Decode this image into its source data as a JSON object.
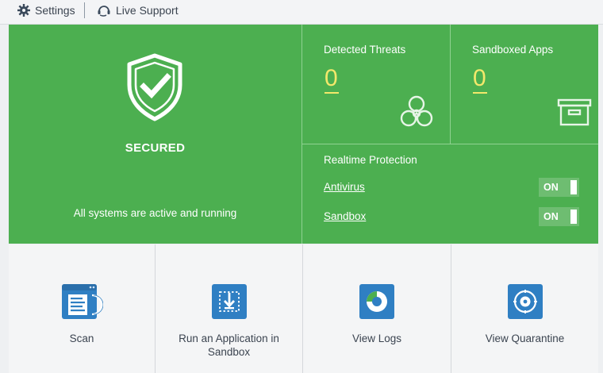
{
  "toolbar": {
    "settings_label": "Settings",
    "settings_icon": "gear-icon",
    "support_label": "Live Support",
    "support_icon": "headset-icon"
  },
  "status": {
    "icon": "shield-check-icon",
    "title": "SECURED",
    "message": "All systems are active and running"
  },
  "threats": {
    "title": "Detected Threats",
    "count": "0",
    "icon": "biohazard-icon"
  },
  "sandboxed": {
    "title": "Sandboxed Apps",
    "count": "0",
    "icon": "sandbox-box-icon"
  },
  "realtime": {
    "title": "Realtime Protection",
    "items": [
      {
        "label": "Antivirus",
        "state": "ON"
      },
      {
        "label": "Sandbox",
        "state": "ON"
      }
    ]
  },
  "tiles": [
    {
      "label": "Scan",
      "icon": "scan-document-icon"
    },
    {
      "label": "Run an Application in Sandbox",
      "icon": "sandbox-run-icon"
    },
    {
      "label": "View Logs",
      "icon": "logs-chart-icon"
    },
    {
      "label": "View Quarantine",
      "icon": "quarantine-vault-icon"
    }
  ],
  "colors": {
    "panel_green": "#4caf50",
    "count_yellow": "#f3e86b",
    "icon_blue": "#2f7fc3"
  }
}
